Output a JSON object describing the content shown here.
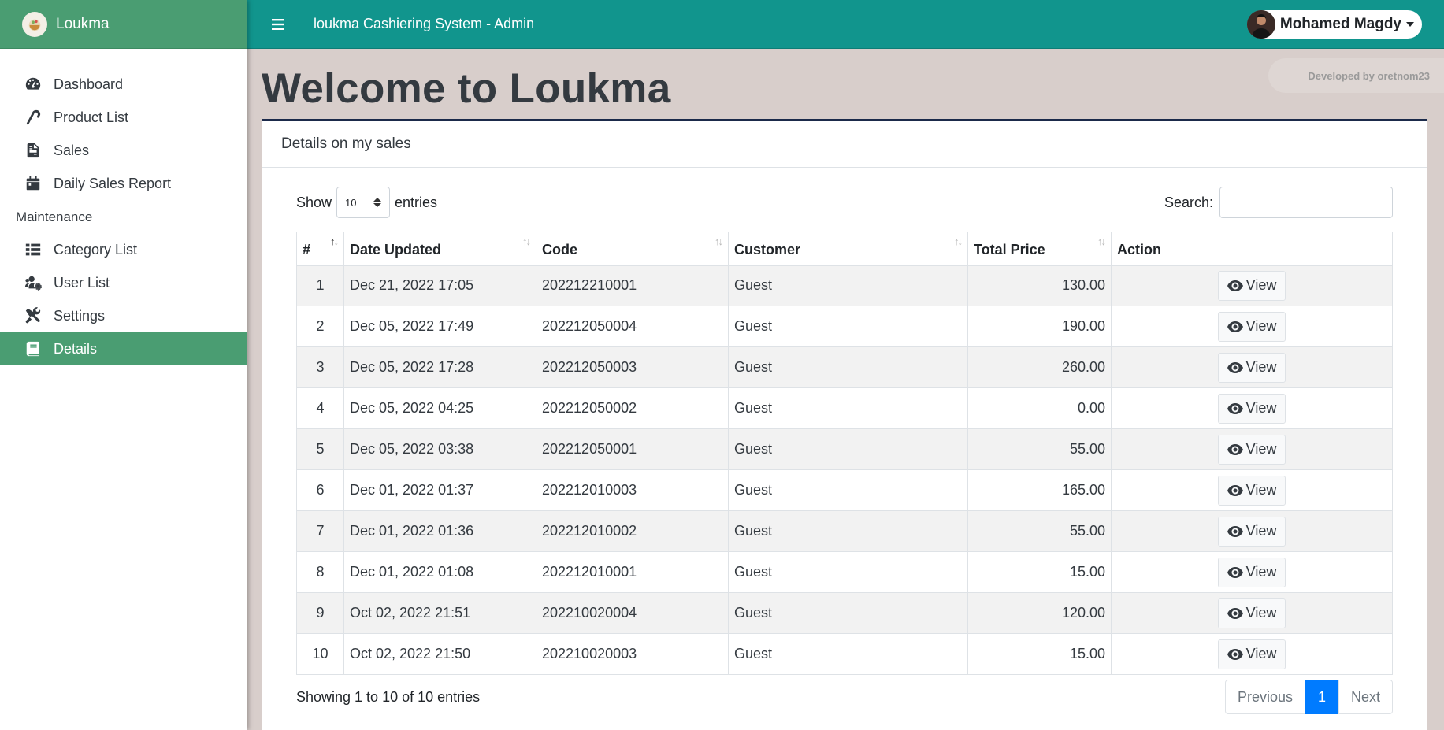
{
  "brand": {
    "name": "Loukma"
  },
  "topbar": {
    "title": "loukma Cashiering System - Admin",
    "user_name": "Mohamed Magdy"
  },
  "sidebar": {
    "items": [
      {
        "label": "Dashboard",
        "icon": "tachometer-icon"
      },
      {
        "label": "Product List",
        "icon": "candy-cane-icon"
      },
      {
        "label": "Sales",
        "icon": "file-invoice-icon"
      },
      {
        "label": "Daily Sales Report",
        "icon": "calendar-icon"
      }
    ],
    "section_header": "Maintenance",
    "maintenance_items": [
      {
        "label": "Category List",
        "icon": "th-list-icon"
      },
      {
        "label": "User List",
        "icon": "users-cog-icon"
      },
      {
        "label": "Settings",
        "icon": "tools-icon"
      },
      {
        "label": "Details",
        "icon": "book-icon",
        "active": true
      }
    ]
  },
  "badge": {
    "text": "Developed by oretnom23"
  },
  "page": {
    "title": "Welcome to Loukma"
  },
  "card": {
    "header": "Details on my sales"
  },
  "controls": {
    "show_label": "Show",
    "entries_value": "10",
    "entries_label": "entries",
    "search_label": "Search:",
    "search_value": ""
  },
  "table": {
    "columns": [
      "#",
      "Date Updated",
      "Code",
      "Customer",
      "Total Price",
      "Action"
    ],
    "rows": [
      {
        "num": "1",
        "date": "Dec 21, 2022 17:05",
        "code": "202212210001",
        "customer": "Guest",
        "total": "130.00",
        "action": "View"
      },
      {
        "num": "2",
        "date": "Dec 05, 2022 17:49",
        "code": "202212050004",
        "customer": "Guest",
        "total": "190.00",
        "action": "View"
      },
      {
        "num": "3",
        "date": "Dec 05, 2022 17:28",
        "code": "202212050003",
        "customer": "Guest",
        "total": "260.00",
        "action": "View"
      },
      {
        "num": "4",
        "date": "Dec 05, 2022 04:25",
        "code": "202212050002",
        "customer": "Guest",
        "total": "0.00",
        "action": "View"
      },
      {
        "num": "5",
        "date": "Dec 05, 2022 03:38",
        "code": "202212050001",
        "customer": "Guest",
        "total": "55.00",
        "action": "View"
      },
      {
        "num": "6",
        "date": "Dec 01, 2022 01:37",
        "code": "202212010003",
        "customer": "Guest",
        "total": "165.00",
        "action": "View"
      },
      {
        "num": "7",
        "date": "Dec 01, 2022 01:36",
        "code": "202212010002",
        "customer": "Guest",
        "total": "55.00",
        "action": "View"
      },
      {
        "num": "8",
        "date": "Dec 01, 2022 01:08",
        "code": "202212010001",
        "customer": "Guest",
        "total": "15.00",
        "action": "View"
      },
      {
        "num": "9",
        "date": "Oct 02, 2022 21:51",
        "code": "202210020004",
        "customer": "Guest",
        "total": "120.00",
        "action": "View"
      },
      {
        "num": "10",
        "date": "Oct 02, 2022 21:50",
        "code": "202210020003",
        "customer": "Guest",
        "total": "15.00",
        "action": "View"
      }
    ]
  },
  "footer": {
    "info": "Showing 1 to 10 of 10 entries",
    "previous": "Previous",
    "page": "1",
    "next": "Next"
  },
  "colors": {
    "sidebar_accent": "#4a9d72",
    "topbar": "#11958d",
    "background": "#d8cecb",
    "pagination_active": "#007bff"
  }
}
